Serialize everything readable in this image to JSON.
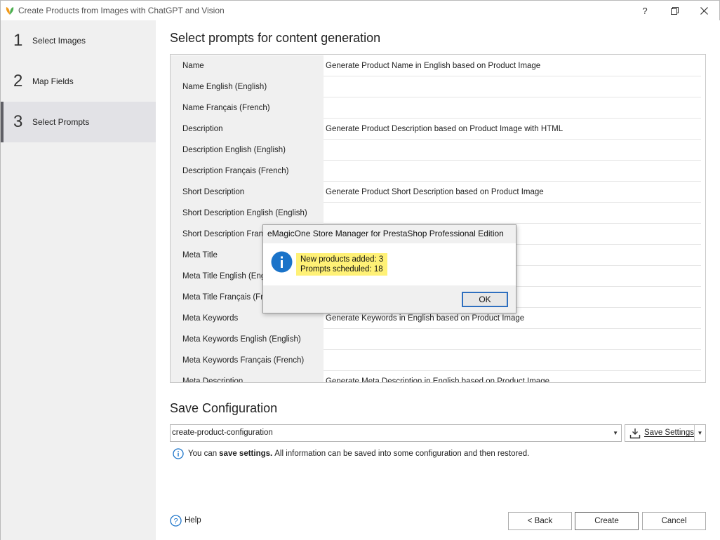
{
  "window": {
    "title": "Create Products from Images with ChatGPT and Vision",
    "help_button": "?"
  },
  "steps": [
    {
      "number": "1",
      "label": "Select Images"
    },
    {
      "number": "2",
      "label": "Map Fields"
    },
    {
      "number": "3",
      "label": "Select Prompts",
      "active": true
    }
  ],
  "prompts": {
    "title": "Select prompts for content generation",
    "rows": [
      {
        "field": "Name",
        "prompt": "Generate Product Name in English based on Product Image"
      },
      {
        "field": "Name English (English)",
        "prompt": ""
      },
      {
        "field": "Name Français (French)",
        "prompt": ""
      },
      {
        "field": "Description",
        "prompt": "Generate Product Description based on Product Image with HTML"
      },
      {
        "field": "Description English (English)",
        "prompt": ""
      },
      {
        "field": "Description Français (French)",
        "prompt": ""
      },
      {
        "field": "Short Description",
        "prompt": "Generate Product Short Description based on Product Image"
      },
      {
        "field": "Short Description English (English)",
        "prompt": ""
      },
      {
        "field": "Short Description Fran",
        "prompt": ""
      },
      {
        "field": "Meta Title",
        "prompt": ""
      },
      {
        "field": "Meta Title English (Eng",
        "prompt": ""
      },
      {
        "field": "Meta Title Français (Fre",
        "prompt": ""
      },
      {
        "field": "Meta Keywords",
        "prompt": "Generate Keywords in English based on Product Image"
      },
      {
        "field": "Meta Keywords English (English)",
        "prompt": ""
      },
      {
        "field": "Meta Keywords Français (French)",
        "prompt": ""
      },
      {
        "field": "Meta Description",
        "prompt": "Generate Meta Description in English based on Product Image"
      }
    ]
  },
  "save_config": {
    "title": "Save Configuration",
    "value": "create-product-configuration",
    "save_button": "Save Settings",
    "info_prefix": "You can",
    "info_bold": "save settings.",
    "info_suffix": "All information can be saved into some configuration and then restored."
  },
  "footer": {
    "help": "Help",
    "back": "< Back",
    "create": "Create",
    "cancel": "Cancel"
  },
  "dialog": {
    "title": "eMagicOne Store Manager for PrestaShop Professional Edition",
    "line1": "New products added: 3",
    "line2": "Prompts scheduled: 18",
    "ok": "OK",
    "highlight_color": "#fff176",
    "icon": "info-icon"
  },
  "colors": {
    "accent_blue": "#1a73c9",
    "sidebar_active": "#e2e2e6"
  }
}
